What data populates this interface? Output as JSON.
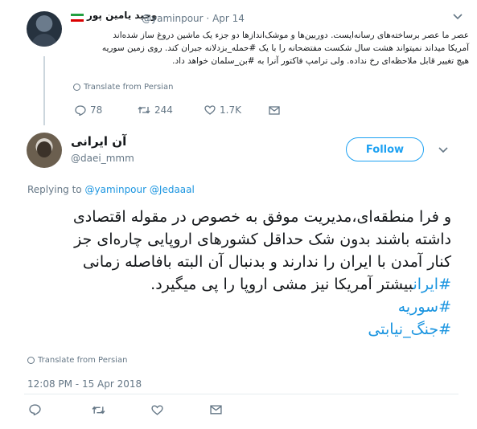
{
  "quoted_tweet": {
    "author_name": "وحید یامین پور",
    "handle": "@yaminpour",
    "date": "Apr 14",
    "text_lines": [
      "عصر ما عصر برساخته‌های رسانه‌ایست. دوربین‌ها و موشک‌اندازها دو جزء یک ماشین دروغ ساز شده‌اند",
      "آمریکا میداند نمیتواند هشت سال شکست مفتضحانه را با یک #حمله_بزدلانه جبران کند. روی زمین سوریه",
      "هیچ تغییر قابل ملاحظه‌ای رخ نداده. ولی ترامپ فاکتور آنرا به #بن_سلمان خواهد داد."
    ],
    "translate_label": "Translate from Persian",
    "reply_count": "78",
    "retweet_count": "244",
    "like_count": "1.7K"
  },
  "reply_tweet": {
    "author_name": "آن ایرانی",
    "handle": "@daei_mmm",
    "follow_label": "Follow",
    "replying_prefix": "Replying to",
    "replying_to_1": "@yaminpour",
    "replying_to_2": "@Jedaaal",
    "text_lines": [
      "و فرا منطقه‌ای،مدیریت موفق به خصوص در مقوله اقتصادی",
      "داشته باشند بدون شک حداقل کشورهای اروپایی چاره‌ای جز",
      "کنار آمدن با ایران را ندارند و بدنبال آن البته بافاصله زمانی",
      "بیشتر آمریکا نیز مشی اروپا را پی میگیرد."
    ],
    "hashtags": [
      "#ایران",
      "#سوریه",
      "#جنگ_نیابتی"
    ],
    "translate_label": "Translate from Persian",
    "timestamp": "12:08 PM - 15 Apr 2018"
  },
  "colors": {
    "link": "#1b95e0",
    "follow": "#1da1f2",
    "muted": "#657786",
    "divider": "#e6ecf0"
  }
}
